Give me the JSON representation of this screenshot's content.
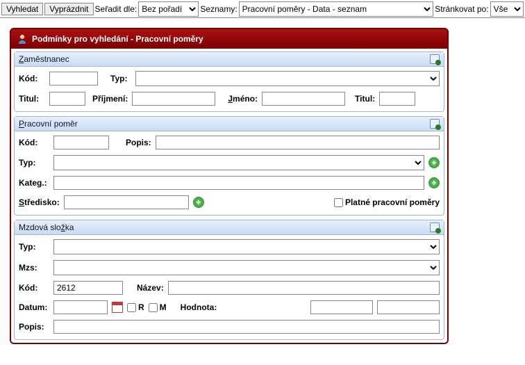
{
  "toolbar": {
    "search_label": "Vyhledat",
    "clear_label": "Vyprázdnit",
    "sort_label": "Seřadit dle:",
    "sort_value": "Bez pořadí",
    "lists_label": "Seznamy:",
    "lists_value": "Pracovní poměry - Data - seznam",
    "paginate_label": "Stránkovat po:",
    "paginate_value": "Vše"
  },
  "panel": {
    "title": "Podmínky pro vyhledání - Pracovní poměry"
  },
  "employee": {
    "title_pre": "Z",
    "title_rest": "aměstnanec",
    "kod_label": "Kód:",
    "typ_label": "Typ:",
    "titul_label": "Titul:",
    "prijmeni_label": "Příjmení:",
    "jmeno_pre": "J",
    "jmeno_rest": "méno:",
    "titul2_label": "Titul:"
  },
  "employment": {
    "title_pre": "P",
    "title_rest": "racovní poměr",
    "kod_label": "Kód:",
    "popis_label": "Popis:",
    "typ_label": "Typ:",
    "kateg_label": "Kateg.:",
    "stredisko_pre": "S",
    "stredisko_rest": "tředisko:",
    "platne_label": "Platné pracovní poměry"
  },
  "wage": {
    "title_pre": "Mzdová slo",
    "title_u": "ž",
    "title_rest": "ka",
    "typ_label": "Typ:",
    "mzs_label": "Mzs:",
    "kod_label": "Kód:",
    "kod_value": "2612",
    "nazev_label": "Název:",
    "datum_label": "Datum:",
    "r_label": "R",
    "m_label": "M",
    "hodnota_label": "Hodnota:",
    "popis_label": "Popis:"
  }
}
